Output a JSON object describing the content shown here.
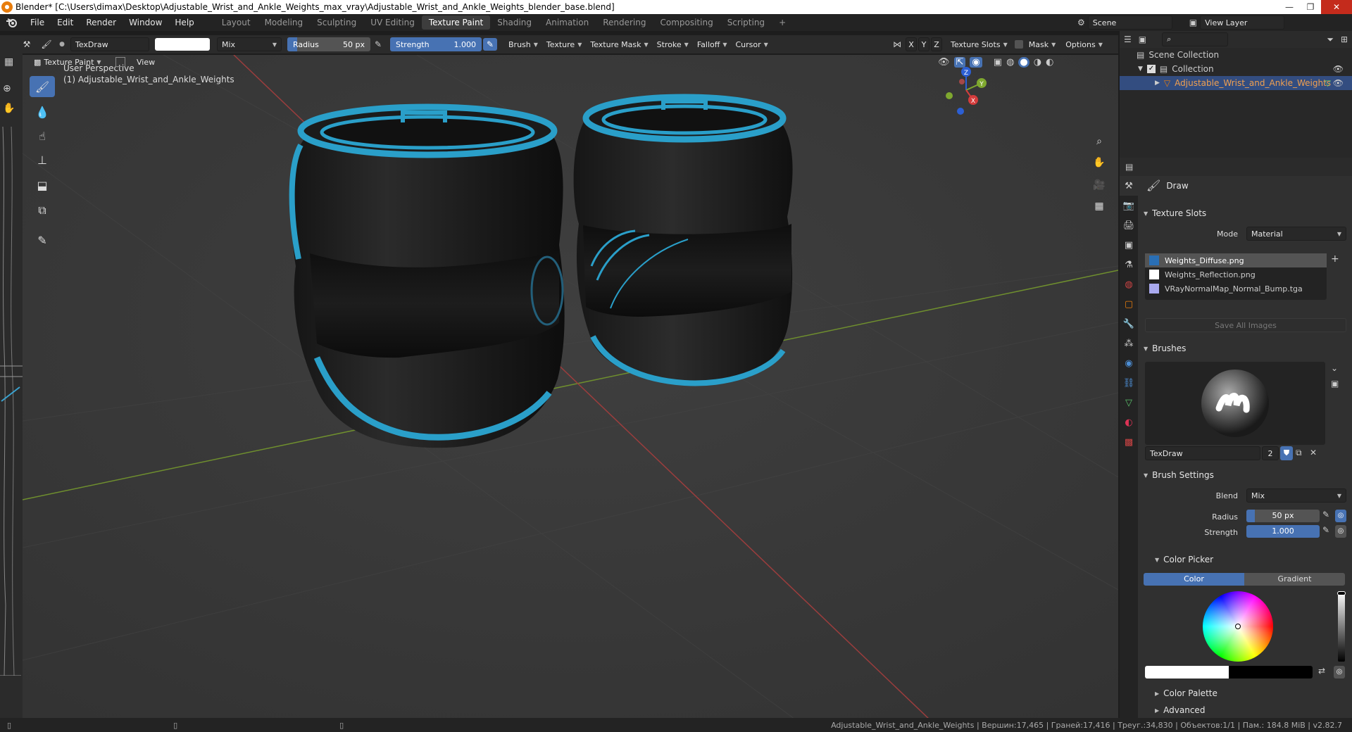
{
  "window": {
    "title": "Blender* [C:\\Users\\dimax\\Desktop\\Adjustable_Wrist_and_Ankle_Weights_max_vray\\Adjustable_Wrist_and_Ankle_Weights_blender_base.blend]",
    "controls": [
      "—",
      "❐",
      "✕"
    ]
  },
  "menu": {
    "items": [
      "File",
      "Edit",
      "Render",
      "Window",
      "Help"
    ]
  },
  "workspaces": [
    "Layout",
    "Modeling",
    "Sculpting",
    "UV Editing",
    "Texture Paint",
    "Shading",
    "Animation",
    "Rendering",
    "Compositing",
    "Scripting"
  ],
  "active_workspace": "Texture Paint",
  "add_workspace": "+",
  "scene": {
    "name": "Scene",
    "view_layer": "View Layer"
  },
  "toolhdr": {
    "brush_name": "TexDraw",
    "blend": "Mix",
    "radius_label": "Radius",
    "radius_value": "50 px",
    "strength_label": "Strength",
    "strength_value": "1.000",
    "menus": [
      "Brush",
      "Texture",
      "Texture Mask",
      "Stroke",
      "Falloff",
      "Cursor"
    ],
    "axes": [
      "X",
      "Y",
      "Z"
    ],
    "right_menus": [
      "Texture Slots",
      "Mask",
      "Options"
    ]
  },
  "viewport": {
    "mode": "Texture Paint",
    "view_menu": "View",
    "perspective": "User Perspective",
    "object_line": "(1) Adjustable_Wrist_and_Ankle_Weights",
    "axis_labels": {
      "z": "Z",
      "y": "Y",
      "x": "X"
    }
  },
  "outliner": {
    "scene_collection": "Scene Collection",
    "collection": "Collection",
    "object": "Adjustable_Wrist_and_Ankle_Weights"
  },
  "properties": {
    "tool_name": "Draw",
    "texture_slots": {
      "header": "Texture Slots",
      "mode_label": "Mode",
      "mode_value": "Material",
      "slots": [
        {
          "name": "Weights_Diffuse.png",
          "swatch": "#2a6fb5"
        },
        {
          "name": "Weights_Reflection.png",
          "swatch": "#ffffff"
        },
        {
          "name": "VRayNormalMap_Normal_Bump.tga",
          "swatch": "#a9a9ee"
        }
      ],
      "save_all": "Save All Images"
    },
    "brushes": {
      "header": "Brushes",
      "brush_name": "TexDraw",
      "users": "2"
    },
    "brush_settings": {
      "header": "Brush Settings",
      "blend_label": "Blend",
      "blend_value": "Mix",
      "radius_label": "Radius",
      "radius_value": "50 px",
      "strength_label": "Strength",
      "strength_value": "1.000"
    },
    "color_picker": {
      "header": "Color Picker",
      "tabs": [
        "Color",
        "Gradient"
      ],
      "active_tab": "Color",
      "value_fraction": 1.0
    },
    "collapsed_panels": [
      "Color Palette",
      "Advanced"
    ]
  },
  "statusbar": {
    "text": "Adjustable_Wrist_and_Ankle_Weights | Вершин:17,465 | Граней:17,416 | Треуг.:34,830 | Объектов:1/1 | Пам.: 184.8 MiB | v2.82.7"
  },
  "colors": {
    "accent": "#4772b3",
    "object_highlight": "#e87d0d",
    "weight_body": "#1b1b1b",
    "weight_trim": "#2a9fc9"
  }
}
